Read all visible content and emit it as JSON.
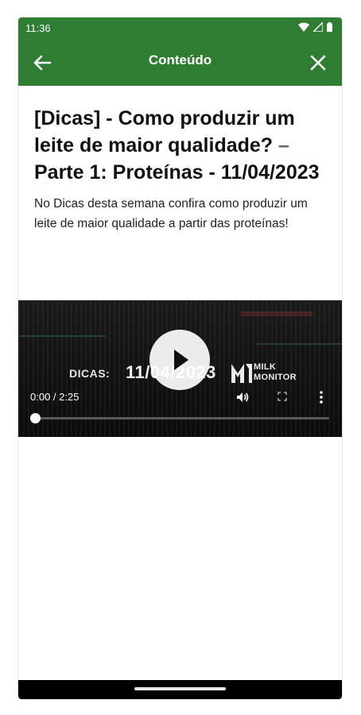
{
  "status": {
    "time": "11:36",
    "icons": [
      "wifi-icon",
      "signal-icon",
      "battery-icon"
    ]
  },
  "appbar": {
    "title": "Conteúdo",
    "back_icon": "arrow-left-icon",
    "close_icon": "close-icon"
  },
  "article": {
    "headline_main": "[Dicas] - Como produzir um leite de maior qualidade?",
    "headline_dash": " –",
    "headline_rest": " Parte 1: Proteínas - 11/04/2023",
    "summary": "No Dicas desta semana confira como produzir um leite de maior qualidade a partir das proteínas!"
  },
  "video": {
    "banner_label": "DICAS:",
    "banner_date": "11/04/2023",
    "logo_line1": "MILK",
    "logo_line2": "MONITOR",
    "time_readout": "0:00 / 2:25",
    "progress": 0,
    "controls": [
      "play-icon",
      "volume-icon",
      "fullscreen-icon",
      "more-vert-icon"
    ]
  },
  "colors": {
    "primary": "#2F7D32",
    "text": "#111111",
    "muted": "#666666"
  }
}
